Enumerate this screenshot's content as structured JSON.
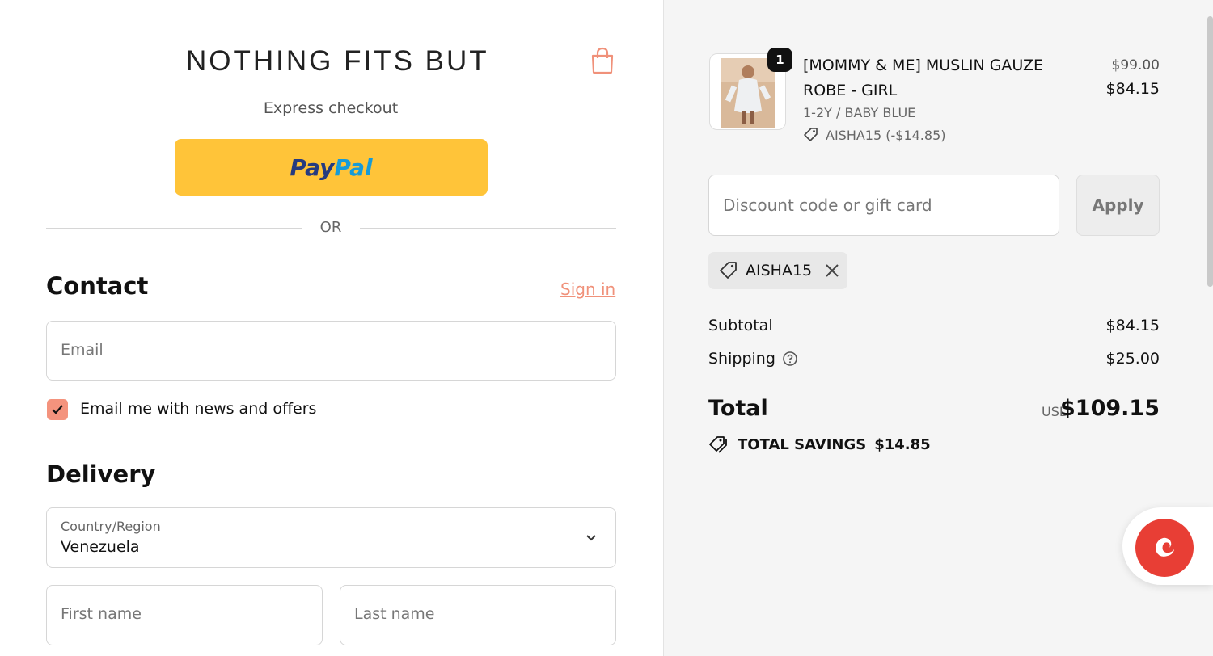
{
  "header": {
    "store_name": "NOTHING FITS BUT",
    "bag_icon": "shopping-bag-icon"
  },
  "express": {
    "label": "Express checkout",
    "paypal_part1": "Pay",
    "paypal_part2": "Pal",
    "paypal_color": "#ffc439"
  },
  "divider": {
    "or_label": "OR"
  },
  "contact": {
    "heading": "Contact",
    "sign_in": "Sign in",
    "email_placeholder": "Email",
    "newsletter_label": "Email me with news and offers",
    "newsletter_checked": true
  },
  "delivery": {
    "heading": "Delivery",
    "country_label": "Country/Region",
    "country_value": "Venezuela",
    "first_name_placeholder": "First name",
    "last_name_placeholder": "Last name"
  },
  "cart": {
    "item": {
      "quantity": "1",
      "name": "[MOMMY & ME] MUSLIN GAUZE ROBE - GIRL",
      "variant": "1-2Y / BABY BLUE",
      "discount": "AISHA15 (-$14.85)",
      "original_price": "$99.00",
      "price": "$84.15"
    },
    "discount_placeholder": "Discount code or gift card",
    "apply_label": "Apply",
    "applied_code": "AISHA15",
    "subtotal_label": "Subtotal",
    "subtotal_value": "$84.15",
    "shipping_label": "Shipping",
    "shipping_value": "$25.00",
    "total_label": "Total",
    "currency": "USD",
    "total_value": "$109.15",
    "savings_label": "TOTAL SAVINGS",
    "savings_value": "$14.85"
  },
  "colors": {
    "accent": "#f4937d",
    "chat": "#e83e35"
  }
}
